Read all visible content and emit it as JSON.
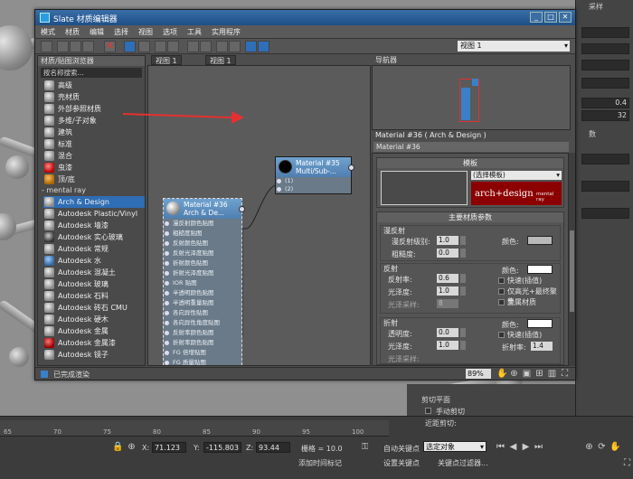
{
  "slate": {
    "title": "Slate 材质编辑器",
    "menu": [
      "模式",
      "材质",
      "编辑",
      "选择",
      "视图",
      "选项",
      "工具",
      "实用程序"
    ],
    "view_select": "视图 1",
    "browser": {
      "header": "材质/贴图浏览器",
      "search_placeholder": "按名称搜索...",
      "items_top": [
        "高级",
        "壳材质",
        "外部参照材质",
        "多维/子对象",
        "建筑",
        "标准",
        "混合",
        "虫漆",
        "顶/底"
      ],
      "group_mental_ray": "- mental ray",
      "items_mr": [
        "Arch & Design",
        "Autodesk Plastic/Vinyl",
        "Autodesk 墙漆",
        "Autodesk 实心玻璃",
        "Autodesk 常规",
        "Autodesk 水",
        "Autodesk 混凝土",
        "Autodesk 玻璃",
        "Autodesk 石料",
        "Autodesk 砖石 CMU",
        "Autodesk 硬木",
        "Autodesk 金属",
        "Autodesk 金属漆",
        "Autodesk 镜子"
      ]
    },
    "view_tabs": [
      "视图 1",
      "视图 1"
    ],
    "nodes": {
      "multi": {
        "title": "Material #35",
        "subtitle": "Multi/Sub-...",
        "slots": [
          "(1)",
          "(2)"
        ]
      },
      "arch": {
        "title": "Material #36",
        "subtitle": "Arch & De...",
        "slots": [
          "漫反射颜色贴图",
          "粗糙度贴图",
          "反射颜色贴图",
          "反射光泽度贴图",
          "折射颜色贴图",
          "折射光泽度贴图",
          "IOR 贴图",
          "半透明颜色贴图",
          "半透明重量贴图",
          "各向异性贴图",
          "各向异性角度贴图",
          "反射率颜色贴图",
          "折射率颜色贴图",
          "FG 倍增贴图",
          "FG 质量贴图"
        ]
      }
    },
    "navigator": {
      "header": "导航器"
    },
    "params": {
      "header": "Material #36  ( Arch & Design )",
      "name": "Material #36",
      "template_title": "模板",
      "template_select": "(选择模板)",
      "logo_text": "arch+design",
      "logo_sub": "mental ray",
      "main_title": "主要材质参数",
      "diffuse": {
        "group": "漫反射",
        "level_label": "漫反射级别:",
        "level": "1.0",
        "rough_label": "粗糙度:",
        "rough": "0.0",
        "color_label": "颜色:",
        "color": "#b9b9b9"
      },
      "reflection": {
        "group": "反射",
        "refl_label": "反射率:",
        "refl": "0.6",
        "gloss_label": "光泽度:",
        "gloss": "1.0",
        "samples_label": "光泽采样:",
        "samples": "8",
        "color_label": "颜色:",
        "color": "#ffffff",
        "chk1": "快速(插值)",
        "chk2": "仅高光+最终聚集",
        "chk3": "金属材质"
      },
      "refraction": {
        "group": "折射",
        "trans_label": "透明度:",
        "trans": "0.0",
        "gloss_label": "光泽度:",
        "gloss": "1.0",
        "samples_label": "光泽采样:",
        "color_label": "颜色:",
        "color": "#ffffff",
        "chk1": "快速(插值)",
        "ior_label": "折射率:",
        "ior": "1.4"
      }
    },
    "status": {
      "text": "已完成渲染",
      "zoom": "89%"
    }
  },
  "max": {
    "timeline_ticks": [
      "65",
      "70",
      "75",
      "80",
      "85",
      "90",
      "95",
      "100"
    ],
    "coords": {
      "x_label": "X:",
      "x": "71.123",
      "y_label": "Y:",
      "y": "-115.803",
      "z_label": "Z:",
      "z": "93.44"
    },
    "grid": "栅格 = 10.0",
    "autokey_label": "自动关键点",
    "autokey_select": "选定对象",
    "setkey_label": "设置关键点",
    "keyfilter_label": "关键点过滤器...",
    "add_time_tag": "添加时间标记",
    "clip_plane": "剪切平面",
    "manual_clip": "手动剪切",
    "near_clip": "近距剪切:",
    "right_panel": {
      "top_label": "采样",
      "num1": "0.4",
      "num2": "32",
      "bottom_label": "数"
    }
  }
}
